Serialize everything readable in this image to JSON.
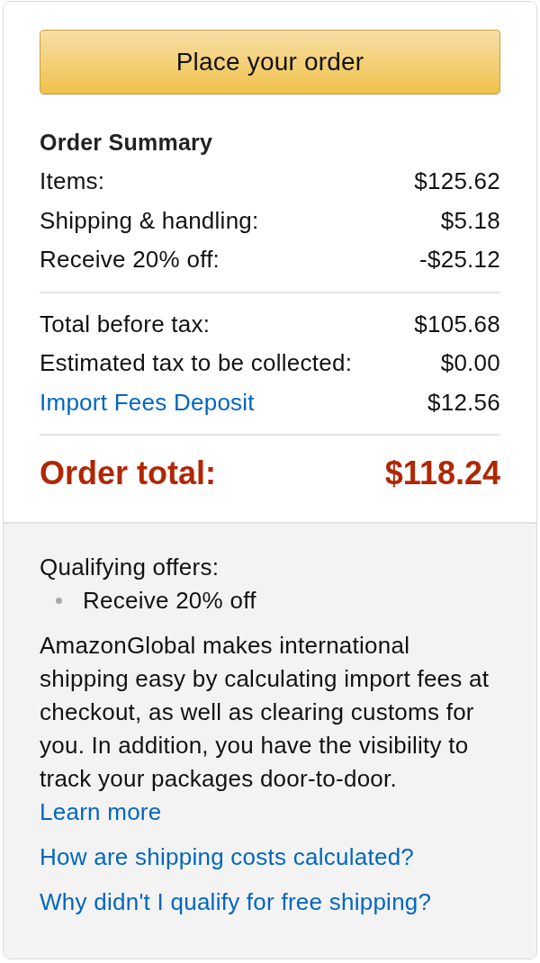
{
  "place_order_button": "Place your order",
  "order_summary": {
    "title": "Order Summary",
    "sections": [
      {
        "rows": [
          {
            "kind": "text",
            "label": "Items:",
            "value": "$125.62"
          },
          {
            "kind": "text",
            "label": "Shipping & handling:",
            "value": "$5.18"
          },
          {
            "kind": "text",
            "label": "Receive 20% off:",
            "value": "-$25.12"
          }
        ]
      },
      {
        "rows": [
          {
            "kind": "text",
            "label": "Total before tax:",
            "value": "$105.68"
          },
          {
            "kind": "text",
            "label": "Estimated tax to be collected:",
            "value": "$0.00"
          },
          {
            "kind": "link",
            "label": "Import Fees Deposit",
            "value": "$12.56"
          }
        ]
      }
    ],
    "total": {
      "label": "Order total:",
      "value": "$118.24"
    }
  },
  "info": {
    "qualifying_offers": {
      "title": "Qualifying offers:",
      "items": [
        "Receive 20% off"
      ]
    },
    "description": {
      "text": "AmazonGlobal makes international shipping easy by calculating import fees at checkout, as well as clearing customs for you. In addition, you have the visibility to track your packages door-to-door.",
      "link": "Learn more"
    },
    "links": [
      "How are shipping costs calculated?",
      "Why didn't I qualify for free shipping?"
    ]
  }
}
